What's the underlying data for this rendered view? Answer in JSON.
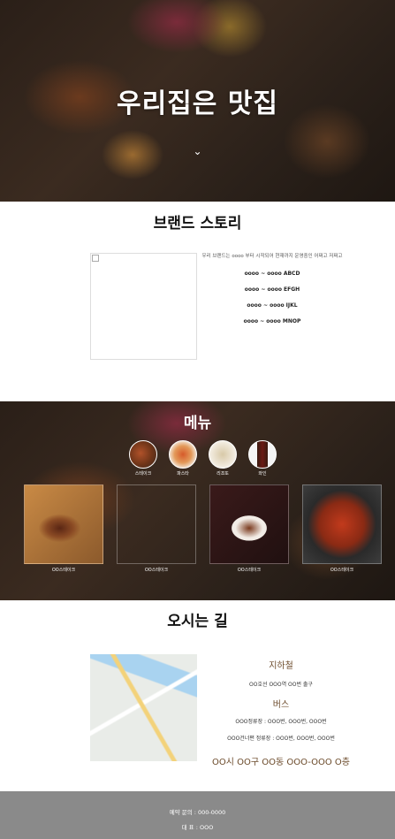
{
  "hero": {
    "title": "우리집은 맛집",
    "arrow": "⌄"
  },
  "brand": {
    "title": "브랜드 스토리",
    "description": "우리 브랜드는 oooo 부터 시작되어 현재까지 운영중인 어쩌고 저쩌고",
    "timeline": [
      "oooo ~ oooo ABCD",
      "oooo ~ oooo EFGH",
      "oooo ~ oooo IJKL",
      "oooo ~ oooo MNOP"
    ]
  },
  "menu": {
    "title": "메뉴",
    "categories": [
      "스테이크",
      "파스타",
      "리조또",
      "와인"
    ],
    "items": [
      "OO스테이크",
      "OO스테이크",
      "OO스테이크",
      "OO스테이크"
    ]
  },
  "location": {
    "title": "오시는 길",
    "subway_title": "지하철",
    "subway_info": "OO호선 OOO역 OO번 출구",
    "bus_title": "버스",
    "bus_lines": [
      "OOO정류장 : OOO번, OOO번, OOO번",
      "OOO건너편 정류장 : OOO번, OOO번, OOO번"
    ],
    "address": "OO시 OO구 OO동 OOO-OOO O층"
  },
  "footer": {
    "reservation": "예약 문의 : 000-0000",
    "representative": "대 표 : OOO"
  }
}
